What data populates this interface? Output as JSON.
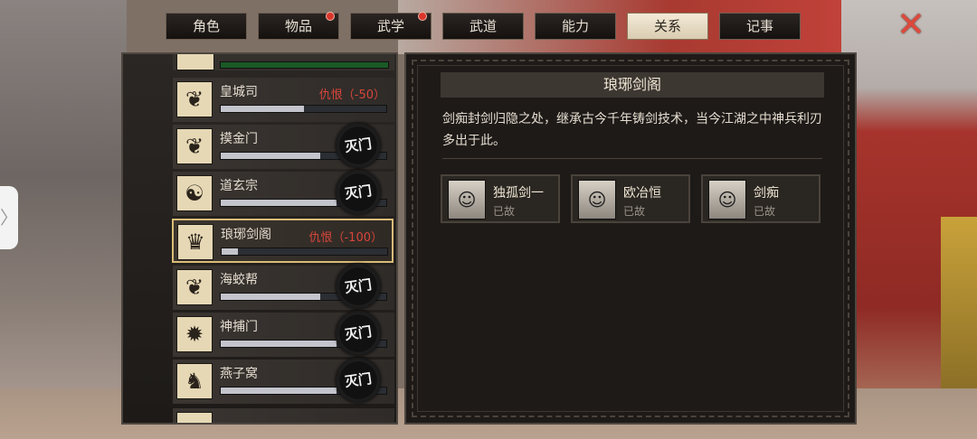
{
  "tabs": [
    {
      "label": "角色",
      "badge": false,
      "active": false
    },
    {
      "label": "物品",
      "badge": true,
      "active": false
    },
    {
      "label": "武学",
      "badge": true,
      "active": false
    },
    {
      "label": "武道",
      "badge": false,
      "active": false
    },
    {
      "label": "能力",
      "badge": false,
      "active": false
    },
    {
      "label": "关系",
      "badge": false,
      "active": true
    },
    {
      "label": "记事",
      "badge": false,
      "active": false
    }
  ],
  "close_icon": "✕",
  "sects": [
    {
      "name": "皇城司",
      "hate": "仇恨（-50）",
      "level": 0.5,
      "destroyed": false,
      "emblem": "❦"
    },
    {
      "name": "摸金门",
      "hate": "",
      "level": 0.6,
      "destroyed": true,
      "emblem": "❦"
    },
    {
      "name": "道玄宗",
      "hate": "",
      "level": 0.7,
      "destroyed": true,
      "emblem": "☯"
    },
    {
      "name": "琅琊剑阁",
      "hate": "仇恨（-100）",
      "level": 0.1,
      "destroyed": false,
      "emblem": "♛",
      "selected": true
    },
    {
      "name": "海蛟帮",
      "hate": "",
      "level": 0.6,
      "destroyed": true,
      "emblem": "❦"
    },
    {
      "name": "神捕门",
      "hate": "",
      "level": 0.7,
      "destroyed": true,
      "emblem": "✹"
    },
    {
      "name": "燕子窝",
      "hate": "",
      "level": 0.7,
      "destroyed": true,
      "emblem": "♞"
    }
  ],
  "seal_label": "灭门",
  "detail": {
    "title": "琅琊剑阁",
    "description": "剑痴封剑归隐之处，继承古今千年铸剑技术，当今江湖之中神兵利刃多出于此。",
    "members": [
      {
        "name": "独孤剑一",
        "status": "已故"
      },
      {
        "name": "欧冶恒",
        "status": "已故"
      },
      {
        "name": "剑痴",
        "status": "已故"
      }
    ]
  },
  "side_handle": "〉"
}
